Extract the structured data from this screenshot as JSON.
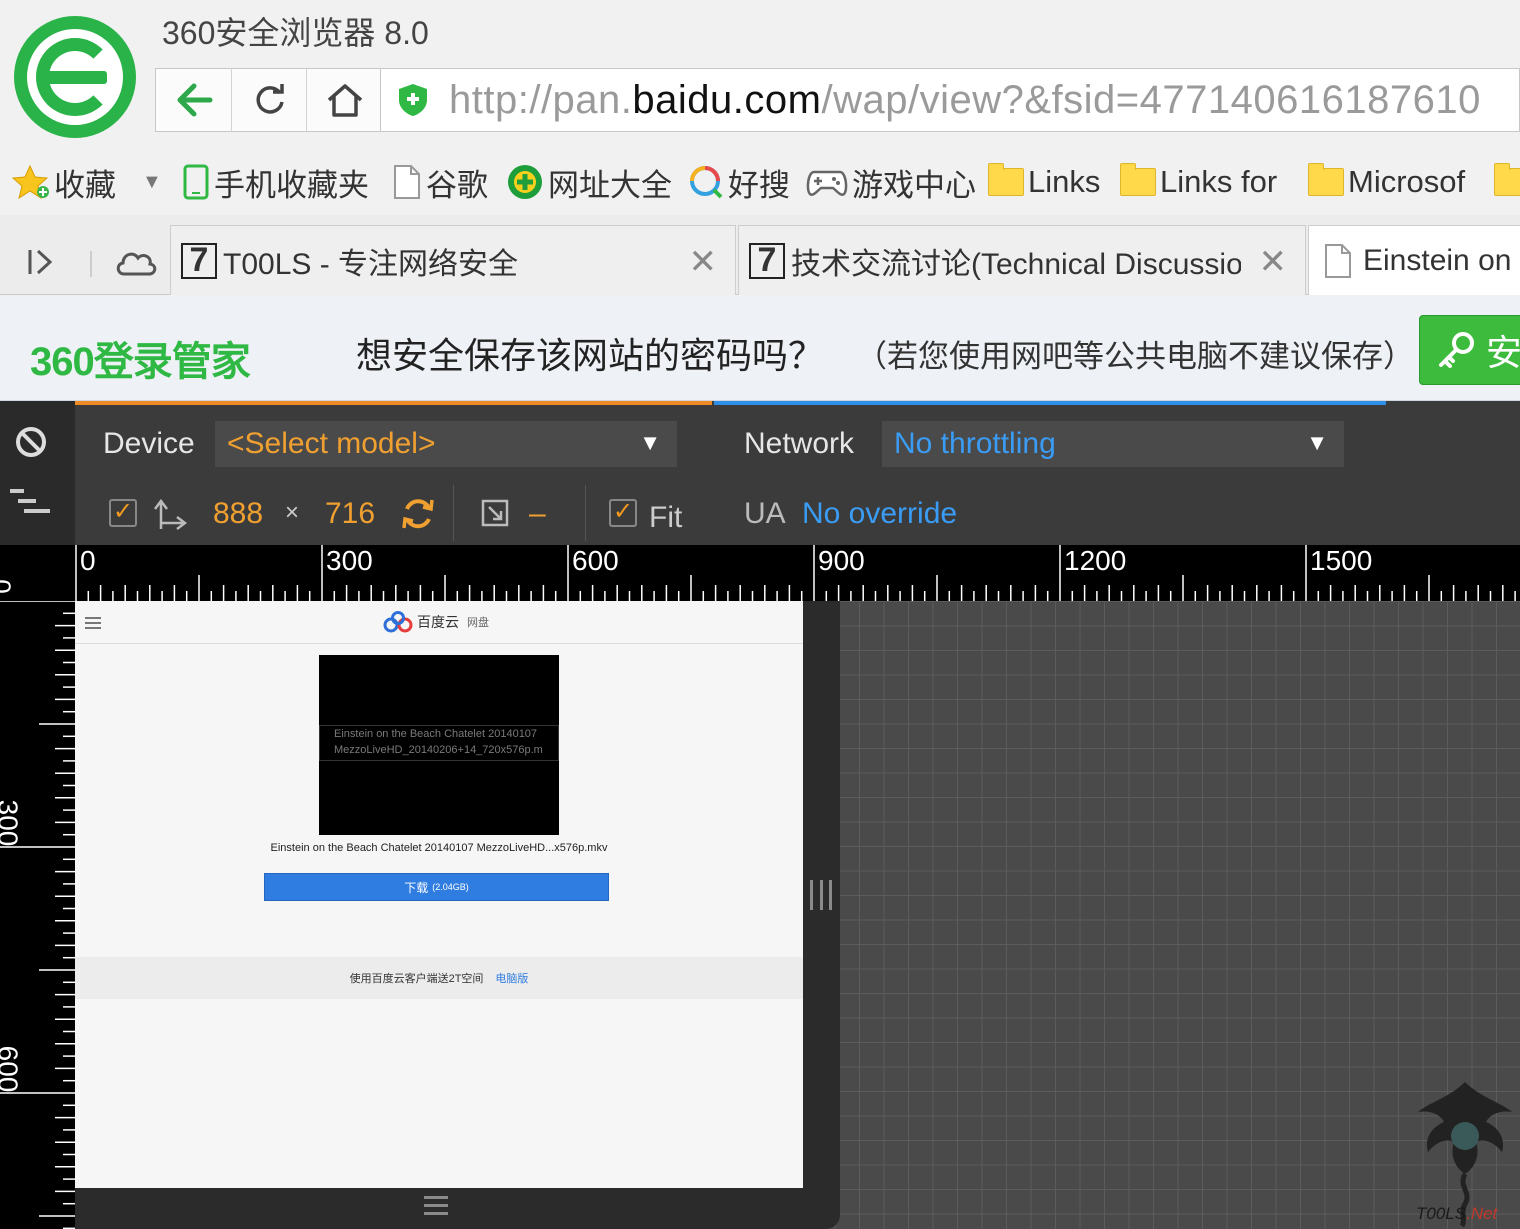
{
  "browser": {
    "app_title": "360安全浏览器 8.0",
    "url_prefix": "http://pan.",
    "url_domain": "baidu.com",
    "url_path": "/wap/view?&fsid=477140616187610"
  },
  "bookmarks": [
    {
      "label": "收藏",
      "icon": "star-icon"
    },
    {
      "label": "手机收藏夹",
      "icon": "phone-icon"
    },
    {
      "label": "谷歌",
      "icon": "page-icon"
    },
    {
      "label": "网址大全",
      "icon": "plus-globe-icon"
    },
    {
      "label": "好搜",
      "icon": "search-ring-icon"
    },
    {
      "label": "游戏中心",
      "icon": "gamepad-icon"
    },
    {
      "label": "Links",
      "icon": "folder-icon"
    },
    {
      "label": "Links for",
      "icon": "folder-icon"
    },
    {
      "label": "Microsof",
      "icon": "folder-icon"
    }
  ],
  "tabs": [
    {
      "label": "T00LS - 专注网络安全",
      "favicon": "7"
    },
    {
      "label": "技术交流讨论(Technical Discussio",
      "favicon": "7"
    },
    {
      "label": "Einstein on",
      "active": true
    }
  ],
  "password_bar": {
    "logo": "360登录管家",
    "message": "想安全保存该网站的密码吗？",
    "note": "（若您使用网吧等公共电脑不建议保存）",
    "button": "安"
  },
  "devtools": {
    "device_label": "Device",
    "device_model": "<Select model>",
    "width": "888",
    "times": "×",
    "height": "716",
    "dash": "–",
    "fit_label": "Fit",
    "network_label": "Network",
    "network_value": "No throttling",
    "ua_label": "UA",
    "ua_value": "No override",
    "accent_device": "#f08a24",
    "accent_network": "#2e8ee8"
  },
  "rulers": {
    "h_labels": [
      "0",
      "300",
      "600",
      "900",
      "1200",
      "1500"
    ],
    "v_labels": [
      "0",
      "300",
      "600"
    ]
  },
  "page": {
    "brand": "百度云",
    "brand_sub": "网盘",
    "video_alt_line1": "Einstein on the Beach Chatelet 20140107",
    "video_alt_line2": "MezzoLiveHD_20140206+14_720x576p.m",
    "filename": "Einstein on the Beach Chatelet 20140107 MezzoLiveHD...x576p.mkv",
    "download_label": "下载",
    "download_size": "(2.04GB)",
    "promo_text": "使用百度云客户端送2T空间",
    "promo_link": "电脑版"
  },
  "watermark": {
    "text_a": "T",
    "text_b": "00LS",
    "text_c": ".Net"
  }
}
